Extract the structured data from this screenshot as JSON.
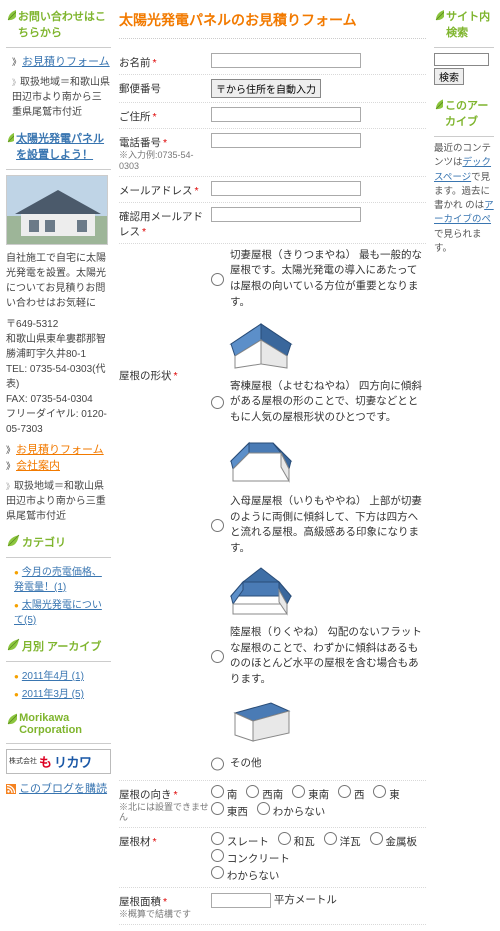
{
  "left": {
    "contact_hd": "お問い合わせはこちらから",
    "links": {
      "estimate_form": "お見積りフォーム"
    },
    "area_note": "取扱地域＝和歌山県田辺市より南から三重県尾鷲市付近",
    "panel_promo": "太陽光発電パネルを設置しよう！",
    "desc": "自社施工で自宅に太陽光発電を設置。太陽光についてお見積りお問い合わせはお気軽に",
    "addr1": "〒649-5312",
    "addr2": "和歌山県東牟婁郡那智勝浦町宇久井80-1",
    "tel": "TEL: 0735-54-0303(代表)",
    "fax": "FAX: 0735-54-0304",
    "free": "フリーダイヤル: 0120-05-7303",
    "link2": "お見積りフォーム",
    "link3": "会社案内",
    "area_note2": "取扱地域＝和歌山県田辺市より南から三重県尾鷲市付近",
    "cat_hd": "カテゴリ",
    "cat1": "今月の売電価格、発電量！(1)",
    "cat2": "太陽光発電について(5)",
    "arch_hd": "月別 アーカイブ",
    "arch1": "2011年4月 (1)",
    "arch2": "2011年3月 (5)",
    "corp_hd": "Morikawa Corporation",
    "logo_pre": "株式会社",
    "logo_m": "も",
    "logo_rest": "リカワ",
    "subscribe": "このブログを購読"
  },
  "main": {
    "title": "太陽光発電パネルのお見積りフォーム",
    "labels": {
      "name": "お名前",
      "zip": "郵便番号",
      "zip_btn": "〒から住所を自動入力",
      "addr": "ご住所",
      "tel": "電話番号",
      "tel_hint": "※入力例:0735-54-0303",
      "mail": "メールアドレス",
      "mail2": "確認用メールアドレス",
      "roof": "屋根の形状",
      "ori": "屋根の向き",
      "ori_hint": "※北には設置できません",
      "mat": "屋根材",
      "area": "屋根面積",
      "area_hint": "※概算で結構です",
      "area_unit": "平方メートル"
    },
    "roofs": [
      {
        "name": "切妻屋根（きりつまやね）",
        "desc": "最も一般的な屋根です。太陽光発電の導入にあたっては屋根の向いている方位が重要となります。"
      },
      {
        "name": "寄棟屋根（よせむねやね）",
        "desc": "四方向に傾斜がある屋根の形のことで、切妻などとともに人気の屋根形状のひとつです。"
      },
      {
        "name": "入母屋屋根（いりもややね）",
        "desc": "上部が切妻のように両側に傾斜して、下方は四方へと流れる屋根。高級感ある印象になります。"
      },
      {
        "name": "陸屋根（りくやね）",
        "desc": "勾配のないフラットな屋根のことで、わずかに傾斜はあるもののほとんど水平の屋根を含む場合もあります。"
      }
    ],
    "roof_other": "その他",
    "ori_opts": [
      "南",
      "西南",
      "東南",
      "西",
      "東",
      "東西",
      "わからない"
    ],
    "mat_opts": [
      "スレート",
      "和瓦",
      "洋瓦",
      "金属板",
      "コンクリート",
      "わからない"
    ]
  },
  "right": {
    "search_hd": "サイト内検索",
    "search_btn": "検索",
    "arch_hd": "このアーカイブ",
    "arch_txt1": "最近のコンテンツは",
    "arch_lnk1": "デックスページ",
    "arch_txt1b": "で見",
    "arch_txt2": "ます。過去に書かれ",
    "arch_txt3": "のは",
    "arch_lnk2": "アーカイブのペ",
    "arch_txt4": "で見られます。"
  }
}
